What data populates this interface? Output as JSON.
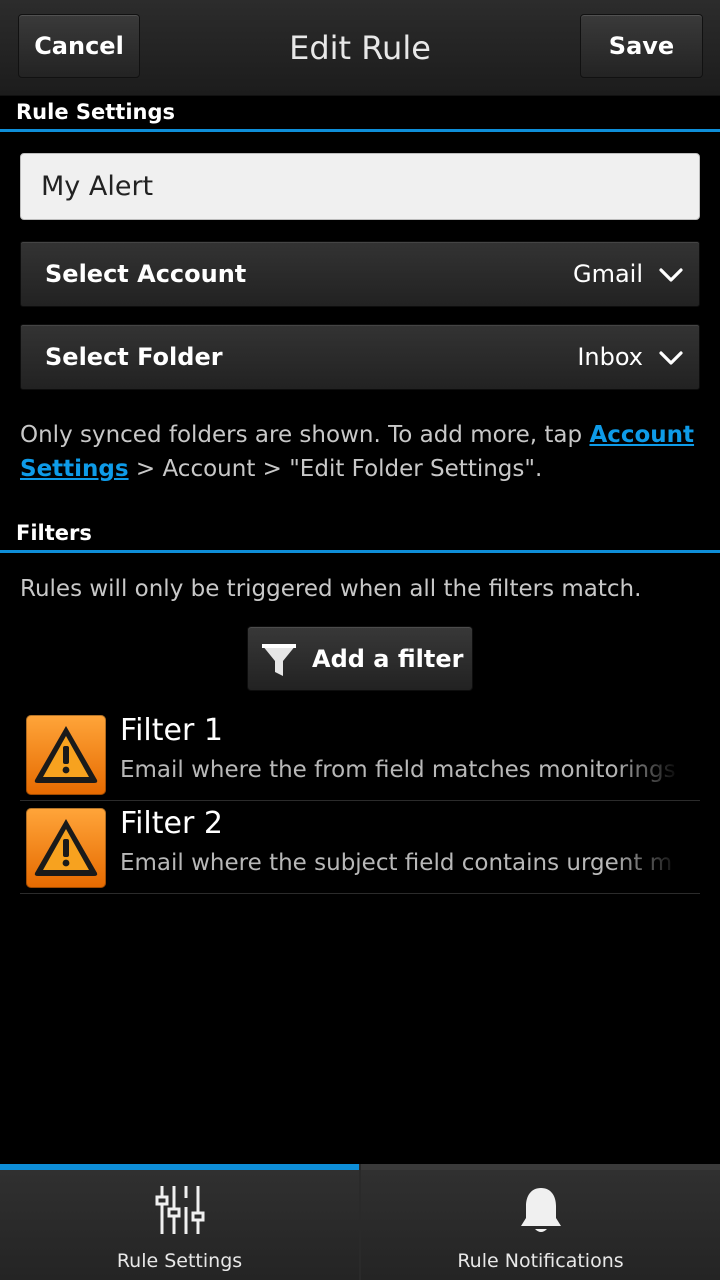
{
  "titlebar": {
    "cancel_label": "Cancel",
    "title": "Edit Rule",
    "save_label": "Save"
  },
  "rule_settings": {
    "header": "Rule Settings",
    "name_value": "My Alert",
    "account": {
      "label": "Select Account",
      "value": "Gmail"
    },
    "folder": {
      "label": "Select Folder",
      "value": "Inbox"
    },
    "hint": {
      "prefix": "Only synced folders are shown. To add more, tap ",
      "link": "Account Settings",
      "suffix": " > Account > \"Edit Folder Settings\"."
    }
  },
  "filters": {
    "header": "Filters",
    "note": "Rules will only be triggered when all the filters match.",
    "add_label": "Add a filter",
    "items": [
      {
        "title": "Filter 1",
        "description": "Email where the from field matches monitorings",
        "icon": "warning-icon"
      },
      {
        "title": "Filter 2",
        "description": "Email where the subject field contains urgent m",
        "icon": "warning-icon"
      }
    ]
  },
  "tabs": [
    {
      "label": "Rule Settings",
      "icon": "sliders-icon",
      "active": true
    },
    {
      "label": "Rule Notifications",
      "icon": "bell-icon",
      "active": false
    }
  ],
  "colors": {
    "accent": "#0e8ed8",
    "link": "#0e9be8",
    "warning_orange": "#f08a10"
  }
}
